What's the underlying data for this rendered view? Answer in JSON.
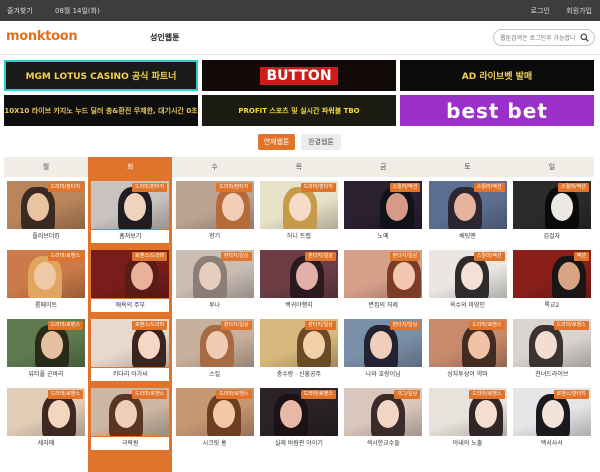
{
  "topbar": {
    "bookmark": "즐겨찾기",
    "date": "08월 14일(화)",
    "login": "로그인",
    "signup": "회원가입"
  },
  "header": {
    "logo": "monktoon",
    "nav_adult": "성인웹툰",
    "search_placeholder": "웹툰검색은 로그인후 가능합니다"
  },
  "banners": [
    {
      "text": "MGM LOTUS CASINO 공식 파트너",
      "bg": "#1a1a1a",
      "fg": "#f5d24a",
      "border": "#2fd0c8"
    },
    {
      "text": "BUTTON",
      "bg": "#120a08",
      "fg": "#ffffff",
      "accent": "#d21a1a"
    },
    {
      "text": "AD 라이브벳 발매",
      "bg": "#0b0b0b",
      "fg": "#f1d35a"
    },
    {
      "text": "10X10 라이브 카지노 누드 딜러 충&환전 무제한, 대기시간 0초",
      "bg": "#0e0e0e",
      "fg": "#e8c75a"
    },
    {
      "text": "PROFIT 스포츠 및 실시간 파워볼 TBO",
      "bg": "#1b1b14",
      "fg": "#f3da3a"
    },
    {
      "text": "best bet",
      "bg": "#9b2fc9",
      "fg": "#ffffff"
    }
  ],
  "tabs": [
    {
      "label": "연재웹툰",
      "active": true
    },
    {
      "label": "완결웹툰",
      "active": false
    }
  ],
  "days": [
    "월",
    "화",
    "수",
    "목",
    "금",
    "토",
    "일"
  ],
  "active_day_index": 1,
  "accent": "#e0742a",
  "rows": [
    [
      {
        "title": "플러브더킹",
        "badge": "드라마/판타지",
        "bg": "#b9855a",
        "skin": "#e9c3a2",
        "hair": "#3a2a22"
      },
      {
        "title": "훔쳐보기",
        "badge": "드라마/판타지",
        "bg": "#c9c3bf",
        "skin": "#f1d2bd",
        "hair": "#1e1e22"
      },
      {
        "title": "향기",
        "badge": "드라마/판타지",
        "bg": "#bda393",
        "skin": "#f3cdb5",
        "hair": "#b56a3a"
      },
      {
        "title": "허니 트랩",
        "badge": "드라마/판타지",
        "bg": "#e8e2c9",
        "skin": "#f6dcc7",
        "hair": "#c59a48"
      },
      {
        "title": "노예",
        "badge": "스릴러/액션",
        "bg": "#2a2030",
        "skin": "#d69b86",
        "hair": "#12121a"
      },
      {
        "title": "배팅맨",
        "badge": "스릴러/액션",
        "bg": "#5d6f91",
        "skin": "#e5b39e",
        "hair": "#2c2630"
      },
      {
        "title": "김걸자",
        "badge": "스릴러/액션",
        "bg": "#2c2a2a",
        "skin": "#ece8e2",
        "hair": "#0a0a0a"
      }
    ],
    [
      {
        "title": "룸메이트",
        "badge": "드라마/로맨스",
        "bg": "#cc7a4a",
        "skin": "#f0c8a6",
        "hair": "#e0a55f"
      },
      {
        "title": "애욕의 주부",
        "badge": "로맨스/드라마",
        "bg": "#7a1d1a",
        "skin": "#e8b29a",
        "hair": "#5a1a16"
      },
      {
        "title": "루나",
        "badge": "판타지/일상",
        "bg": "#cabdb3",
        "skin": "#e6cfbf",
        "hair": "#8b7e76"
      },
      {
        "title": "백귀야행지",
        "badge": "판타지/일상",
        "bg": "#6c3e44",
        "skin": "#e2b0a8",
        "hair": "#2a1a20"
      },
      {
        "title": "변집의 처제",
        "badge": "판타지/일상",
        "bg": "#d7a08b",
        "skin": "#f3c6b0",
        "hair": "#7a3e26"
      },
      {
        "title": "옥수의 마땅인",
        "badge": "스릴러/액션",
        "bg": "#eae7e3",
        "skin": "#f4e1d6",
        "hair": "#2d2b2b"
      },
      {
        "title": "록교2",
        "badge": "액션",
        "bg": "#8a1f1a",
        "skin": "#d9a385",
        "hair": "#1a1616"
      }
    ],
    [
      {
        "title": "뷰티풀 군바리",
        "badge": "드라마/로맨스",
        "bg": "#5f7a4e",
        "skin": "#e4c0a0",
        "hair": "#2a2a1a"
      },
      {
        "title": "키다리 아가씨",
        "badge": "로맨스/드라마",
        "bg": "#e9d9cd",
        "skin": "#f6d7c5",
        "hair": "#3a2420"
      },
      {
        "title": "스킬",
        "badge": "판타지/일상",
        "bg": "#c9b09c",
        "skin": "#f0ccb4",
        "hair": "#a66b42"
      },
      {
        "title": "중수랑 · 신흥공주",
        "badge": "판타지/일상",
        "bg": "#d8b87c",
        "skin": "#f2d0a8",
        "hair": "#6b4a26"
      },
      {
        "title": "나와 호랑이님",
        "badge": "판타지/일상",
        "bg": "#7a8fa8",
        "skin": "#efcfbb",
        "hair": "#222233"
      },
      {
        "title": "상자투성이 약마",
        "badge": "드라마/로맨스",
        "bg": "#c78a6c",
        "skin": "#f1c3a6",
        "hair": "#412b22"
      },
      {
        "title": "천녀드라이브",
        "badge": "드라마/로맨스",
        "bg": "#d8d4cf",
        "skin": "#f3ddd0",
        "hair": "#3b3232"
      }
    ],
    [
      {
        "title": "세자매",
        "badge": "드라마/로맨스",
        "bg": "#e2ccb6",
        "skin": "#f4d6c0",
        "hair": "#3c2a22"
      },
      {
        "title": "극락원",
        "badge": "드라마/로맨스",
        "bg": "#cdb8a4",
        "skin": "#efcdb6",
        "hair": "#5a3424"
      },
      {
        "title": "시크릿 홈",
        "badge": "드라마/로맨스",
        "bg": "#c79673",
        "skin": "#f2c9a8",
        "hair": "#6d3e22"
      },
      {
        "title": "실제 바람판 아이기",
        "badge": "드라마/로맨스",
        "bg": "#2a2226",
        "skin": "#e7b8a5",
        "hair": "#1a1214"
      },
      {
        "title": "섹시한교수들",
        "badge": "개그/일상",
        "bg": "#d9c6bd",
        "skin": "#f3d5c6",
        "hair": "#3a2a2a"
      },
      {
        "title": "아내의 노출",
        "badge": "드라마/로맨스",
        "bg": "#e8e2dc",
        "skin": "#f6ddcf",
        "hair": "#302626"
      },
      {
        "title": "백서사서",
        "badge": "로맨스/판타지",
        "bg": "#e6e6e8",
        "skin": "#f3e3da",
        "hair": "#1a1a1e"
      }
    ]
  ]
}
